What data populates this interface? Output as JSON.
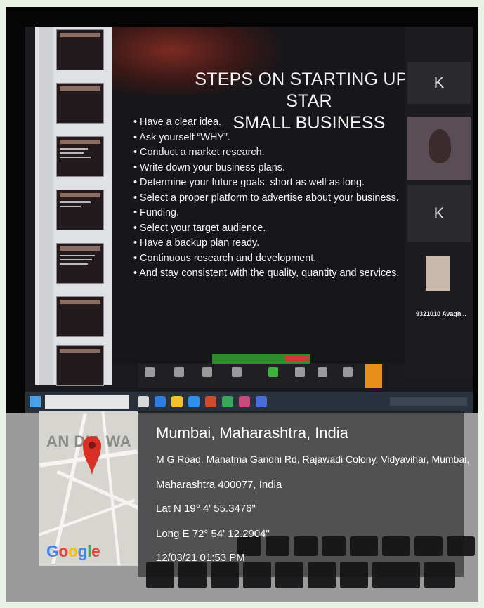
{
  "slide": {
    "title_line1": "STEPS ON STARTING UP A STAR",
    "title_line2": "SMALL BUSINESS",
    "bullets": [
      "Have a clear idea.",
      "Ask yourself “WHY”.",
      "Conduct a market research.",
      "Write down your business plans.",
      "Determine your future goals: short as well as long.",
      "Select a proper platform to advertise about your business.",
      "Funding.",
      "Select your target audience.",
      "Have a backup plan ready.",
      "Continuous research and development.",
      "And stay consistent with the quality, quantity and services."
    ]
  },
  "participants": {
    "tile1_initial": "K",
    "tile2_initial": "K",
    "caller_label": "9321010 Avagh..."
  },
  "geotag": {
    "map_caption": "AN  DIA WA",
    "brand": "Google",
    "brand_colors": [
      "#4285F4",
      "#EA4335",
      "#FBBC05",
      "#4285F4",
      "#34A853",
      "#EA4335"
    ],
    "pin_color": "#d93025",
    "city": "Mumbai, Maharashtra, India",
    "address_line1": "M G Road, Mahatma Gandhi Rd, Rajawadi Colony, Vidyavihar, Mumbai,",
    "address_line2": "Maharashtra 400077, India",
    "latitude": "Lat N 19° 4' 55.3476\"",
    "longitude": "Long E 72° 54' 12.2904\"",
    "datetime": "12/03/21 01:53 PM"
  }
}
